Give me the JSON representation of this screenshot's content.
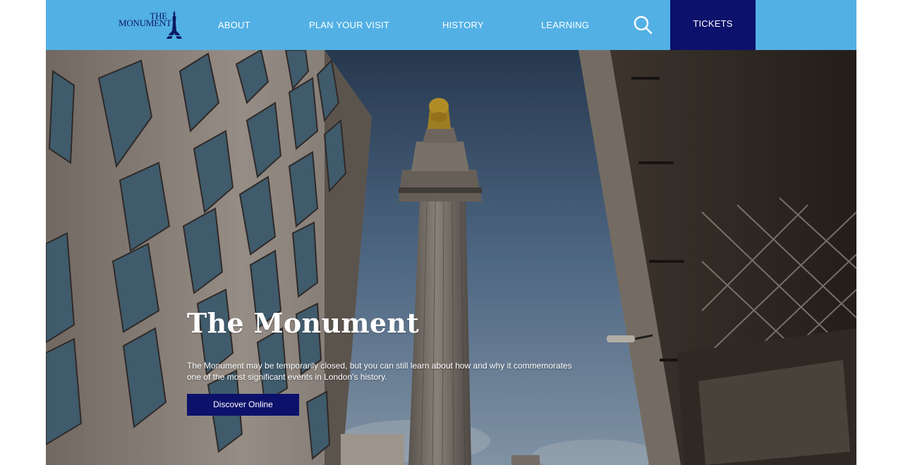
{
  "header": {
    "logo": {
      "line1": "THE",
      "line2": "MONUMENT"
    },
    "nav": [
      {
        "label": "ABOUT"
      },
      {
        "label": "PLAN YOUR VISIT"
      },
      {
        "label": "HISTORY"
      },
      {
        "label": "LEARNING"
      }
    ],
    "search_icon": "search-icon",
    "tickets_label": "TICKETS"
  },
  "hero": {
    "title": "The Monument",
    "description": "The Monument may be temporarily closed, but you can still learn about how and why it commemorates one of the most significant events in London's history.",
    "cta_label": "Discover Online",
    "image": "monument-column-photo"
  },
  "colors": {
    "header_bg": "#52b0e5",
    "brand_navy": "#0c116b",
    "text_on_dark": "#ffffff"
  }
}
